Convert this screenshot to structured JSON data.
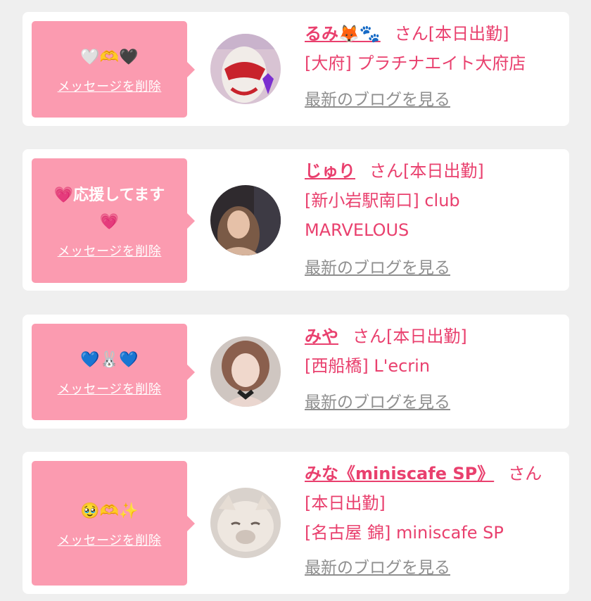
{
  "delete_label": "メッセージを削除",
  "blog_label": "最新のブログを見る",
  "cards": [
    {
      "name": "るみ🦊🐾",
      "suffix": "さん[本日出勤]",
      "shop": "[大府] プラチナエイト大府店",
      "message": "🤍🫶🖤"
    },
    {
      "name": "じゅり",
      "suffix": "さん[本日出勤]",
      "shop": "[新小岩駅南口] club MARVELOUS",
      "message": "💗応援してます💗"
    },
    {
      "name": "みや",
      "suffix": "さん[本日出勤]",
      "shop": "[西船橋] L'ecrin",
      "message": "💙🐰💙"
    },
    {
      "name": "みな《miniscafe SP》",
      "suffix": "さん[本日出勤]",
      "shop": "[名古屋 錦] miniscafe SP",
      "message": "🥹🫶✨"
    }
  ],
  "colors": {
    "background": "#efefef",
    "bubble": "#fb9bb0",
    "accent": "#e9406e",
    "link_gray": "#8f8f8f"
  }
}
